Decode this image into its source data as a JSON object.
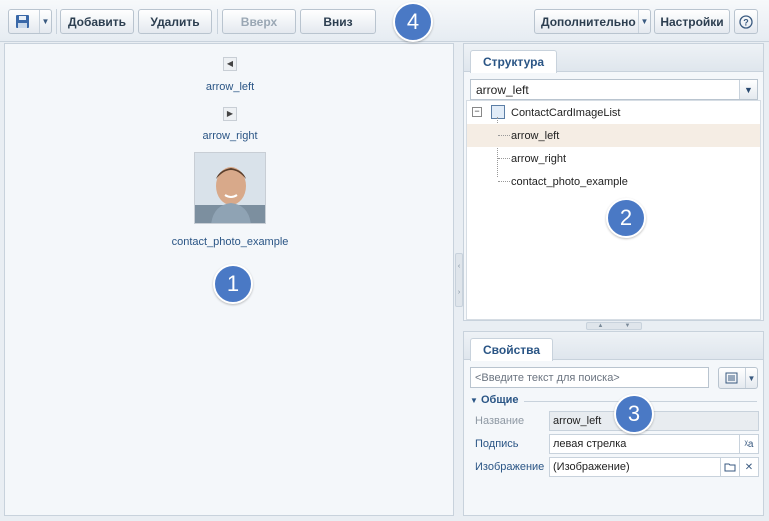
{
  "toolbar": {
    "add_label": "Добавить",
    "delete_label": "Удалить",
    "up_label": "Вверх",
    "down_label": "Вниз",
    "more_label": "Дополнительно",
    "settings_label": "Настройки"
  },
  "badges": [
    "1",
    "2",
    "3",
    "4"
  ],
  "images": [
    {
      "label": "arrow_left",
      "icon": "arrow-left-icon"
    },
    {
      "label": "arrow_right",
      "icon": "arrow-right-icon"
    },
    {
      "label": "contact_photo_example",
      "icon": "photo-thumbnail"
    }
  ],
  "structure": {
    "tab_label": "Структура",
    "selected_value": "arrow_left",
    "tree": {
      "root": "ContactCardImageList",
      "children": [
        "arrow_left",
        "arrow_right",
        "contact_photo_example"
      ],
      "selected_index": 0
    }
  },
  "properties": {
    "tab_label": "Свойства",
    "search_placeholder": "<Введите текст для поиска>",
    "group_title": "Общие",
    "rows": [
      {
        "label": "Название",
        "value": "arrow_left",
        "disabled": true
      },
      {
        "label": "Подпись",
        "value": "левая стрелка",
        "disabled": false
      },
      {
        "label": "Изображение",
        "value": "(Изображение)",
        "disabled": false
      }
    ]
  },
  "colors": {
    "accent": "#2a5585",
    "badge": "#4a79c5",
    "selected_row": "#f5ede4"
  }
}
